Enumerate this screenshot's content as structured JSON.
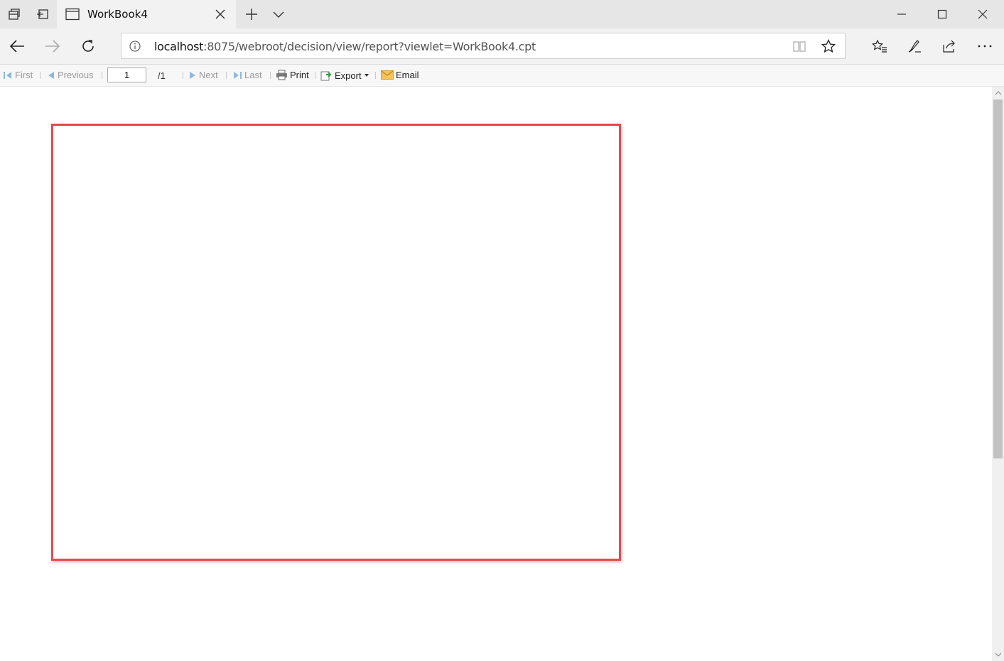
{
  "window": {
    "tab_title": "WorkBook4",
    "minimize_icon": "minimize-icon",
    "maximize_icon": "maximize-icon",
    "close_icon": "close-icon"
  },
  "address_bar": {
    "url_host": "localhost",
    "url_path": ":8075/webroot/decision/view/report?viewlet=WorkBook4.cpt"
  },
  "toolbar": {
    "first_label": "First",
    "previous_label": "Previous",
    "page_value": "1",
    "page_total": "/1",
    "next_label": "Next",
    "last_label": "Last",
    "print_label": "Print",
    "export_label": "Export",
    "email_label": "Email"
  },
  "colors": {
    "frame_border": "#e9474d",
    "tab_bar": "#e6e6e6",
    "nav_bar": "#f2f2f2",
    "disabled_text": "#9a9a9a",
    "nav_arrow_blue": "#5b9bd5"
  }
}
